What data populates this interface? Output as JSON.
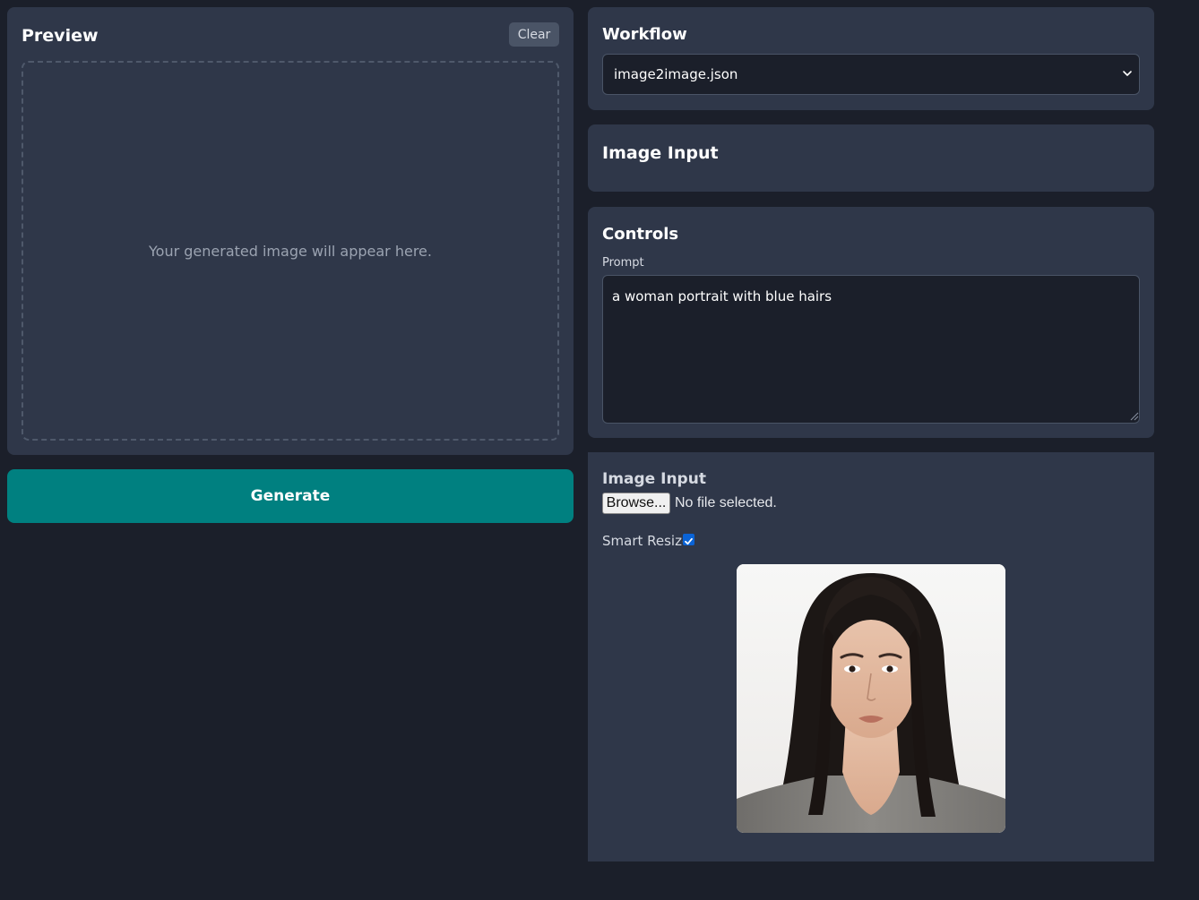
{
  "preview": {
    "title": "Preview",
    "clear_label": "Clear",
    "placeholder": "Your generated image will appear here."
  },
  "generate": {
    "label": "Generate"
  },
  "workflow": {
    "title": "Workflow",
    "selected": "image2image.json"
  },
  "image_input_section": {
    "title": "Image Input"
  },
  "controls": {
    "title": "Controls",
    "prompt_label": "Prompt",
    "prompt_value": "a woman portrait with blue hairs"
  },
  "image_input": {
    "title": "Image Input",
    "browse_label": "Browse...",
    "file_status": "No file selected.",
    "smart_resize_label": "Smart Resize",
    "smart_resize_checked": true
  },
  "colors": {
    "background": "#1b1f2a",
    "card": "#2f3749",
    "accent": "#008080",
    "checkbox": "#0a63d6"
  }
}
